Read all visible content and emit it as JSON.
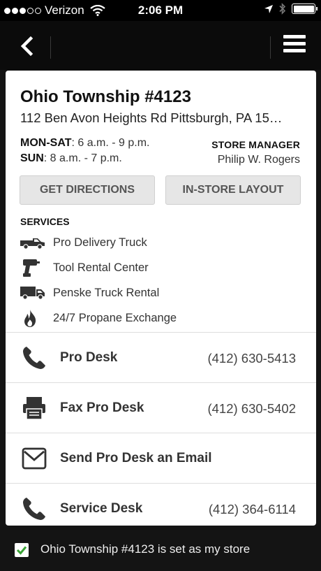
{
  "status_bar": {
    "carrier": "Verizon",
    "time": "2:06 PM",
    "signal_bars_filled": 3,
    "signal_bars_total": 5
  },
  "nav": {
    "back_icon": "chevron-left-icon",
    "menu_icon": "hamburger-menu-icon"
  },
  "store": {
    "name": "Ohio Township #4123",
    "address": "112 Ben Avon Heights Rd Pittsburgh, PA 15…",
    "hours": [
      {
        "days": "MON-SAT",
        "time": ": 6 a.m. - 9 p.m."
      },
      {
        "days": "SUN",
        "time": ": 8 a.m. - 7 p.m."
      }
    ],
    "manager_label": "STORE MANAGER",
    "manager_name": "Philip W. Rogers"
  },
  "actions": {
    "directions_label": "GET DIRECTIONS",
    "layout_label": "IN-STORE LAYOUT"
  },
  "services": {
    "label": "SERVICES",
    "items": [
      {
        "label": "Pro Delivery Truck",
        "icon": "pickup-truck-icon"
      },
      {
        "label": "Tool Rental Center",
        "icon": "drill-icon"
      },
      {
        "label": "Penske Truck Rental",
        "icon": "box-truck-icon"
      },
      {
        "label": "24/7 Propane Exchange",
        "icon": "flame-icon"
      }
    ]
  },
  "contacts": [
    {
      "label": "Pro Desk",
      "phone": "(412) 630-5413",
      "icon": "phone-icon"
    },
    {
      "label": "Fax Pro Desk",
      "phone": "(412) 630-5402",
      "icon": "fax-icon"
    },
    {
      "label": "Send Pro Desk an Email",
      "phone": "",
      "icon": "envelope-icon"
    },
    {
      "label": "Service Desk",
      "phone": "(412) 364-6114",
      "icon": "phone-icon"
    }
  ],
  "footer": {
    "my_store_text": "Ohio Township #4123 is set as my store",
    "checked": true
  },
  "colors": {
    "background": "#141414",
    "card": "#ffffff",
    "check_green": "#3aa335"
  }
}
